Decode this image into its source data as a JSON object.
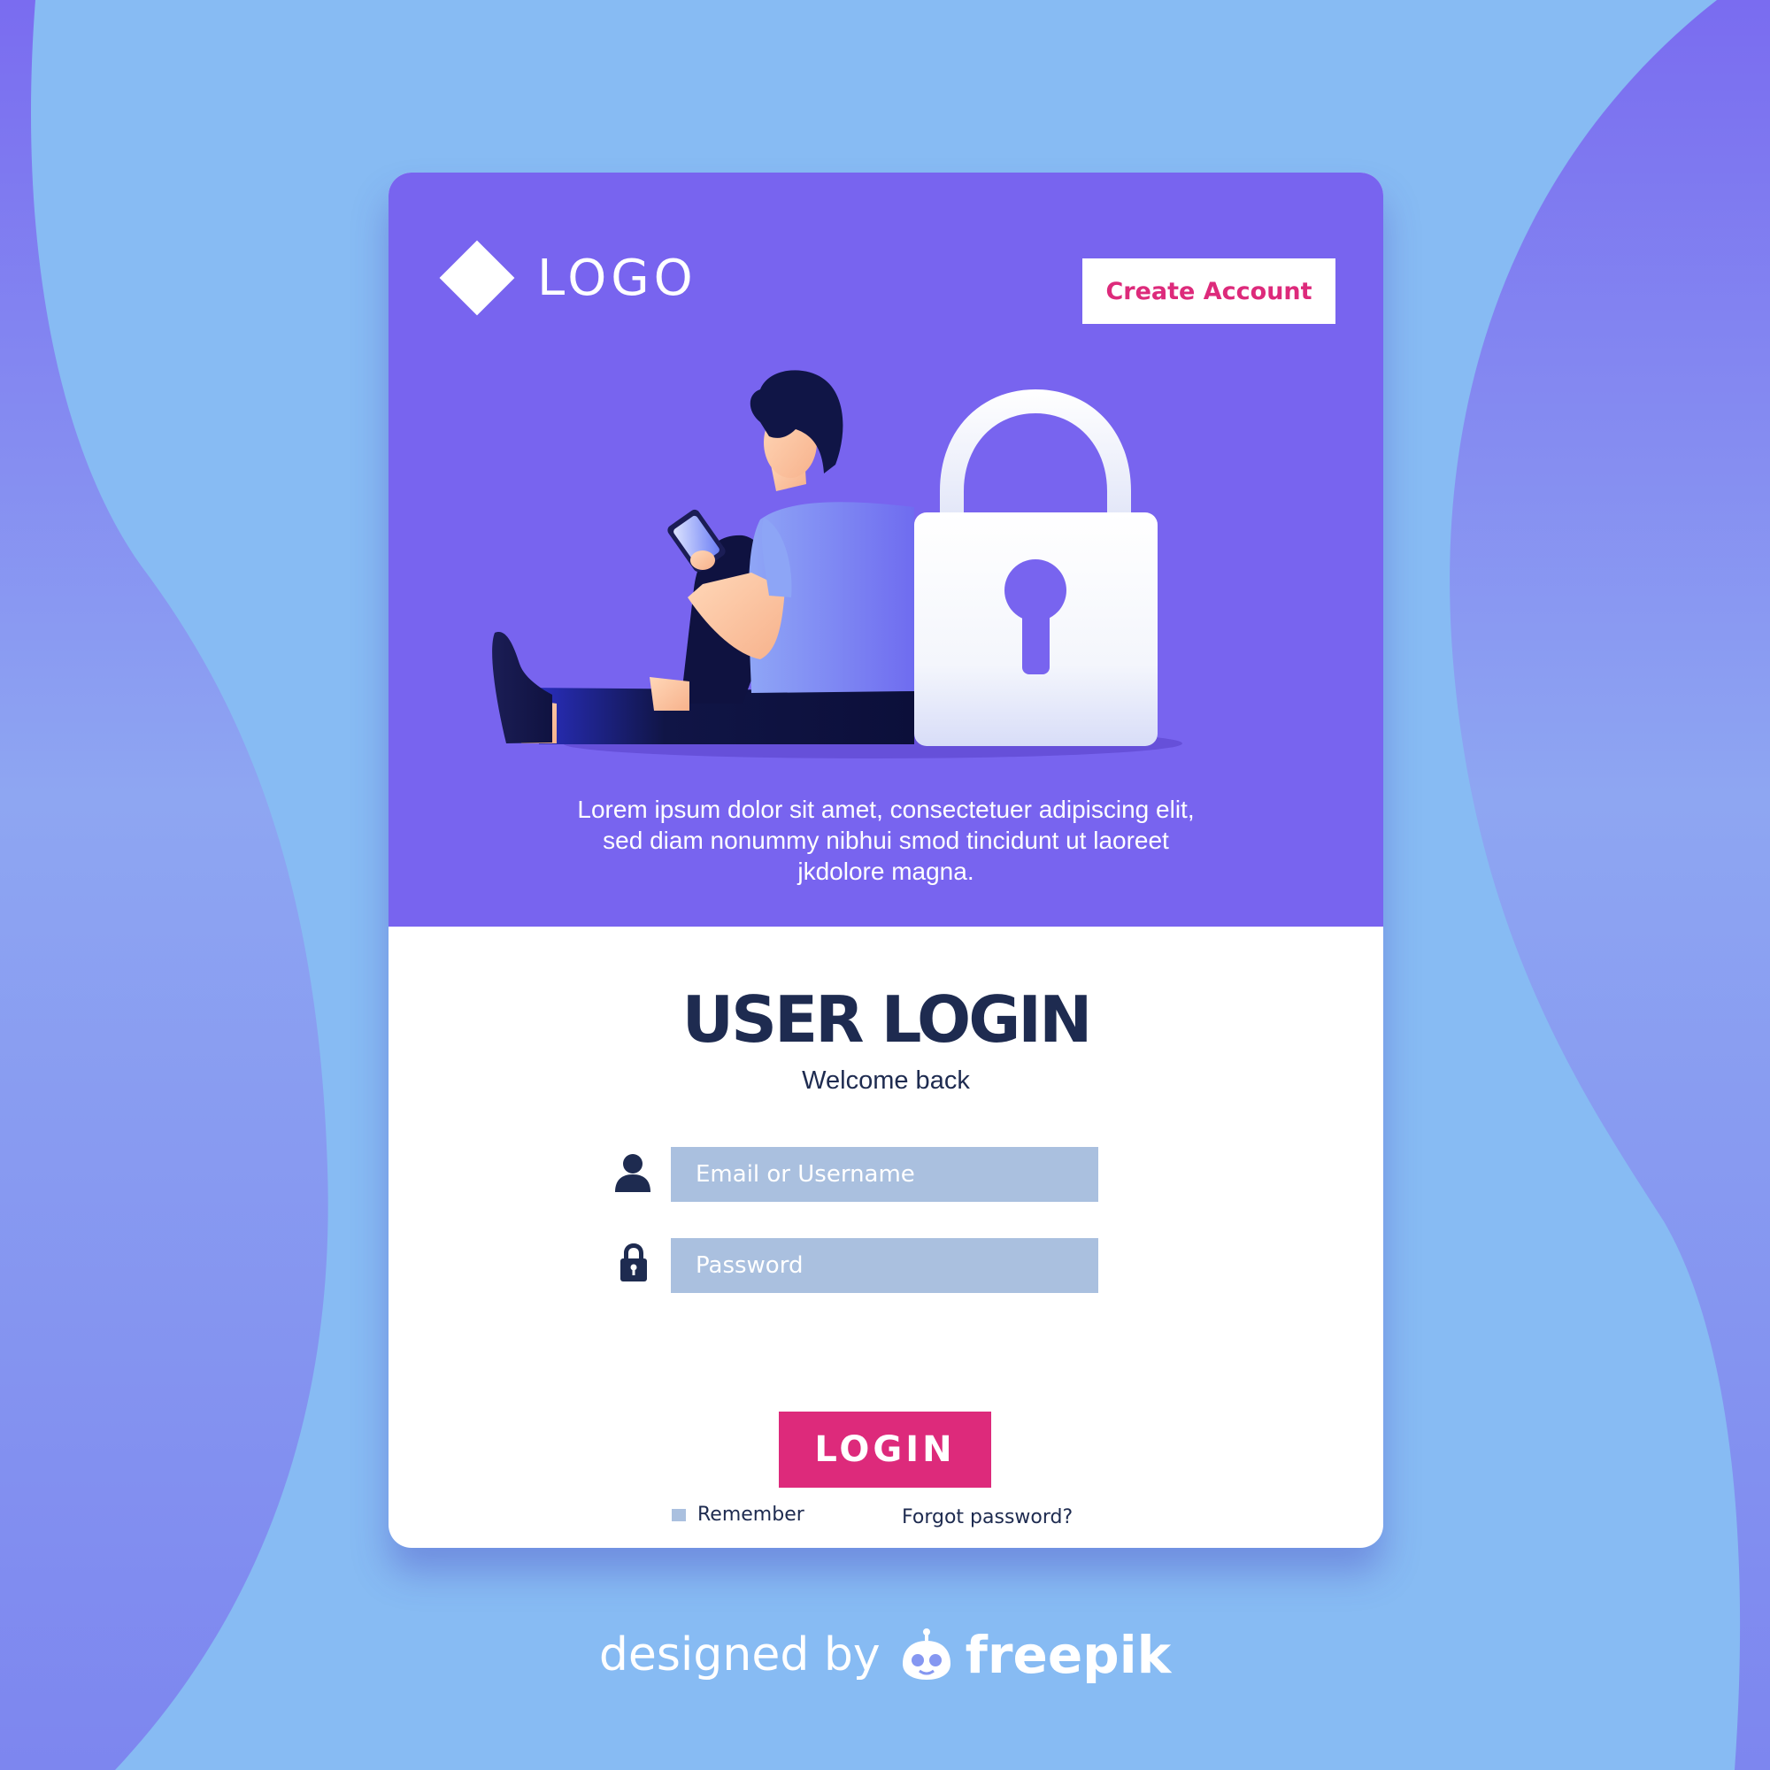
{
  "header": {
    "logo_text": "LOGO",
    "create_account_label": "Create Account"
  },
  "intro": {
    "lorem": "Lorem ipsum dolor sit amet, consectetuer adipiscing elit, sed diam nonummy nibhui smod tincidunt ut laoreet jkdolore magna."
  },
  "login": {
    "title": "USER LOGIN",
    "subtitle": "Welcome back",
    "email_placeholder": "Email or Username",
    "password_placeholder": "Password",
    "remember_label": "Remember",
    "remember_checked": false,
    "forgot_label": "Forgot password?",
    "button_label": "LOGIN"
  },
  "credit": {
    "prefix": "designed by",
    "brand": "freepik"
  },
  "icons": {
    "logo": "diamond-icon",
    "email_field": "user-icon",
    "password_field": "lock-icon",
    "illustration": "padlock-icon",
    "credit_logo": "freepik-logo"
  },
  "colors": {
    "header_purple": "#7864ef",
    "accent_pink": "#dd2a7b",
    "input_fill": "#aac0df",
    "text_navy": "#1e2b50",
    "background_blue": "#87bbf3"
  }
}
